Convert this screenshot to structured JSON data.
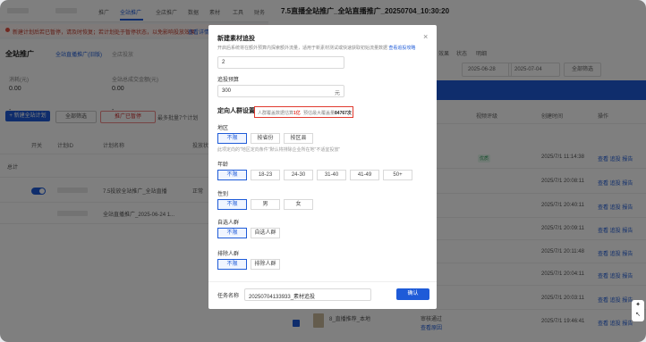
{
  "bg_left": {
    "nav": [
      "推广",
      "全站推广",
      "全店推广",
      "数据",
      "素材",
      "工具",
      "财务"
    ],
    "alert_text": "新建计划后若已暂停，请及时恢复；若计划处于暂停状态，以免影响投放效果",
    "alert_link": "查看详情",
    "title": "全站推广",
    "tabs": [
      "全站直播推广(旧版)",
      "全店投放"
    ],
    "stats": [
      {
        "label": "消耗(元)",
        "value": "0.00"
      },
      {
        "label": "全站总成交金额(元)",
        "value": "0.00"
      }
    ],
    "btn_new": "+ 新建全站计划",
    "btn_filter": "全部筛选",
    "btn_warn": "推广已暂停",
    "warn_note": "最多批量7个计划",
    "headers": [
      "开关",
      "计划ID",
      "计划名称",
      "投放状态"
    ],
    "rows": [
      {
        "name": "总计"
      },
      {
        "name": "7.5投放全站推广_全站直播",
        "status": "正常"
      },
      {
        "name": "全站直播推广_2025-06-24 1..."
      }
    ]
  },
  "bg_right": {
    "title": "7.5直播全站推广_全站直播推广_20250704_10:30:20",
    "tabs": [
      "效果",
      "状态",
      "明细"
    ],
    "date_start": "2025-06-28",
    "date_end": "2025-07-04",
    "filter_btn": "全部筛选",
    "headers": [
      "视频评级",
      "创建时间",
      "操作"
    ],
    "rows": [
      {
        "time": "2025/7/1 11:14:38",
        "ops": "查看 追投 报告"
      },
      {
        "time": "2025/7/1 20:08:11",
        "ops": "查看 追投 报告"
      },
      {
        "time": "2025/7/1 20:40:11",
        "ops": "查看 追投 报告"
      },
      {
        "time": "2025/7/1 20:09:11",
        "ops": "查看 追投 报告"
      },
      {
        "time": "2025/7/1 20:11:48",
        "ops": "查看 追投 报告"
      },
      {
        "time": "2025/7/1 20:04:11",
        "ops": "查看 追投 报告"
      },
      {
        "time": "2025/7/1 20:03:11",
        "ops": "查看 追投 报告"
      },
      {
        "time": "2025/7/1 19:46:41",
        "ops": "查看 追投 报告"
      }
    ],
    "badge": "优质",
    "last_row_name": "8_直播推荐_本地",
    "last_row_note": "审核通过",
    "last_row_link": "查看原因"
  },
  "modal": {
    "title": "新建素材追投",
    "description": "开启后系统将在额外预算内探索额外流量，适用于新素材测试或快速获取初始流量数据",
    "description_link": "查看追投攻略",
    "count_value": "2",
    "budget_label": "追投预算",
    "budget_value": "300",
    "budget_unit": "元",
    "section_title": "定向人群设置",
    "coverage_label": "人群覆盖数据估算",
    "coverage_value": "1亿",
    "reach_label": "预估最大覆盖量",
    "reach_value": "84767次",
    "region_label": "地区",
    "region_options": [
      "不限",
      "按省份",
      "按区县"
    ],
    "region_note": "此项定向的\"地区定向条件\"默认将排除企业所在地\"不适宜投放\"",
    "age_label": "年龄",
    "age_options": [
      "不限",
      "18-23",
      "24-30",
      "31-40",
      "41-49",
      "50+"
    ],
    "gender_label": "性别",
    "gender_options": [
      "不限",
      "男",
      "女"
    ],
    "custom_label": "自选人群",
    "custom_options": [
      "不限",
      "自选人群"
    ],
    "exclude_label": "排除人群",
    "exclude_options": [
      "不限",
      "排除人群"
    ],
    "task_label": "任务名称",
    "task_value": "20250704133933_素材追投",
    "confirm": "确认"
  }
}
